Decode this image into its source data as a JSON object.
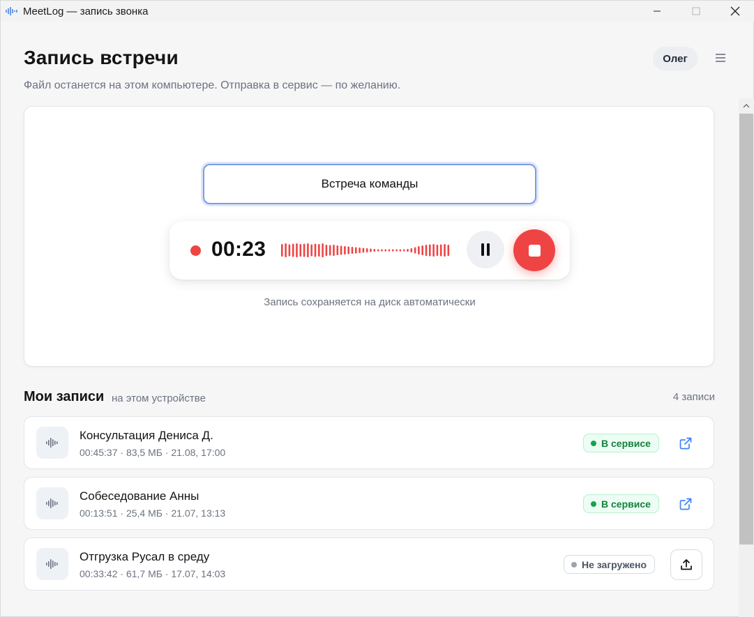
{
  "window": {
    "title": "MeetLog — запись звонка"
  },
  "header": {
    "title": "Запись встречи",
    "subtitle": "Файл останется на этом компьютере. Отправка в сервис — по желанию.",
    "user": "Олег"
  },
  "recorder": {
    "title_value": "Встреча команды",
    "timer": "00:23",
    "hint": "Запись сохраняется на диск автоматически",
    "colors": {
      "record": "#ef4444",
      "focus": "#7d9be8"
    }
  },
  "recordings": {
    "title": "Мои записи",
    "subtitle": "на этом устройстве",
    "count": "4 записи",
    "items": [
      {
        "title": "Консультация Дениса Д.",
        "meta": "00:45:37 · 83,5 МБ · 21.08, 17:00",
        "status": "В сервисе",
        "status_kind": "uploaded",
        "action_icon": "external-link-icon"
      },
      {
        "title": "Собеседование Анны",
        "meta": "00:13:51 · 25,4 МБ · 21.07, 13:13",
        "status": "В сервисе",
        "status_kind": "uploaded",
        "action_icon": "external-link-icon"
      },
      {
        "title": "Отгрузка Русал в среду",
        "meta": "00:33:42 · 61,7 МБ · 17.07, 14:03",
        "status": "Не загружено",
        "status_kind": "local",
        "action_icon": "upload-icon"
      }
    ]
  }
}
